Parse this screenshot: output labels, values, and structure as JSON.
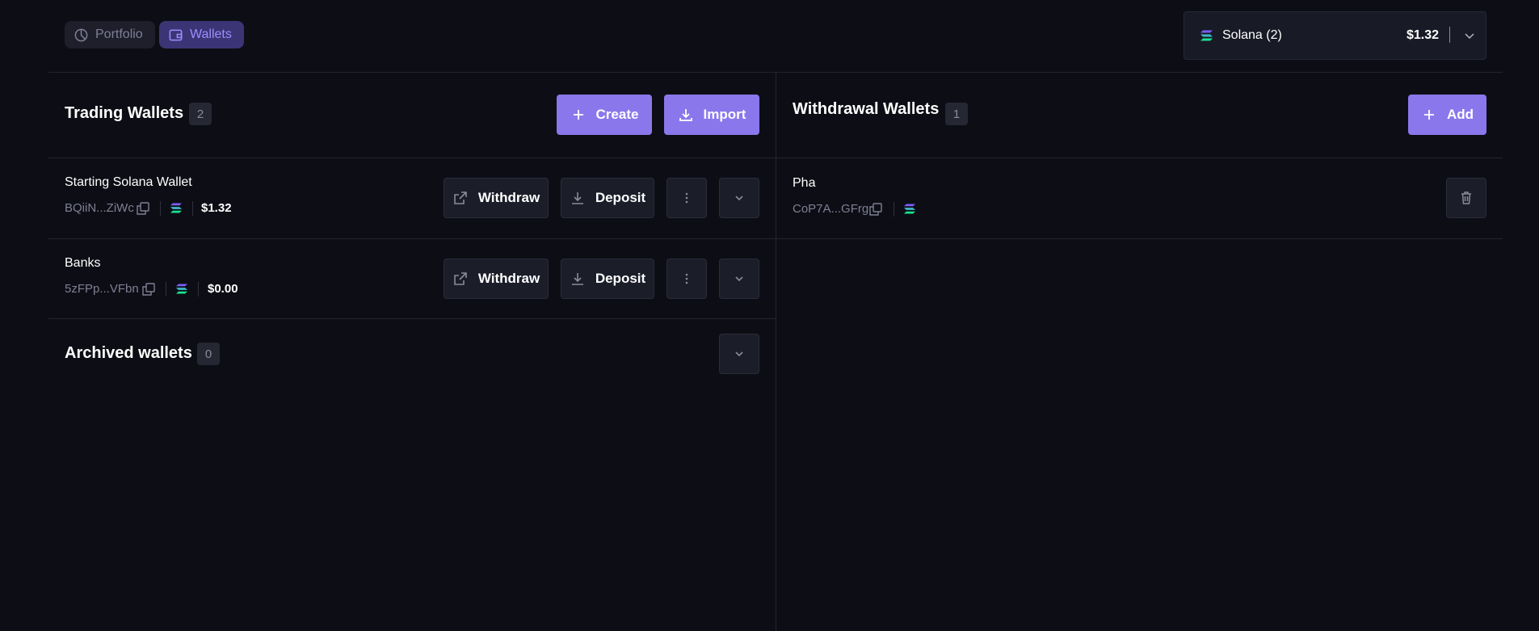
{
  "nav": {
    "tabs": [
      {
        "label": "Portfolio",
        "icon": "pie-chart-icon",
        "active": false
      },
      {
        "label": "Wallets",
        "icon": "wallet-icon",
        "active": true
      }
    ]
  },
  "chain_selector": {
    "chain_name": "Solana (2)",
    "balance": "$1.32",
    "icon": "solana-icon"
  },
  "trading": {
    "title": "Trading Wallets",
    "count": "2",
    "create_label": "Create",
    "import_label": "Import",
    "wallets": [
      {
        "name": "Starting Solana Wallet",
        "address": "BQiiN...ZiWc",
        "balance": "$1.32",
        "withdraw_label": "Withdraw",
        "deposit_label": "Deposit"
      },
      {
        "name": "Banks",
        "address": "5zFPp...VFbn",
        "balance": "$0.00",
        "withdraw_label": "Withdraw",
        "deposit_label": "Deposit"
      }
    ]
  },
  "archived": {
    "title": "Archived wallets",
    "count": "0"
  },
  "withdrawal": {
    "title": "Withdrawal Wallets",
    "count": "1",
    "add_label": "Add",
    "wallets": [
      {
        "name": "Pha",
        "address": "CoP7A...GFrg"
      }
    ]
  },
  "colors": {
    "background": "#0d0e15",
    "accent": "#8b77ec",
    "muted_text": "#7e7f95",
    "button_dark": "#1b1d29",
    "active_tab_bg": "#3b3575"
  }
}
